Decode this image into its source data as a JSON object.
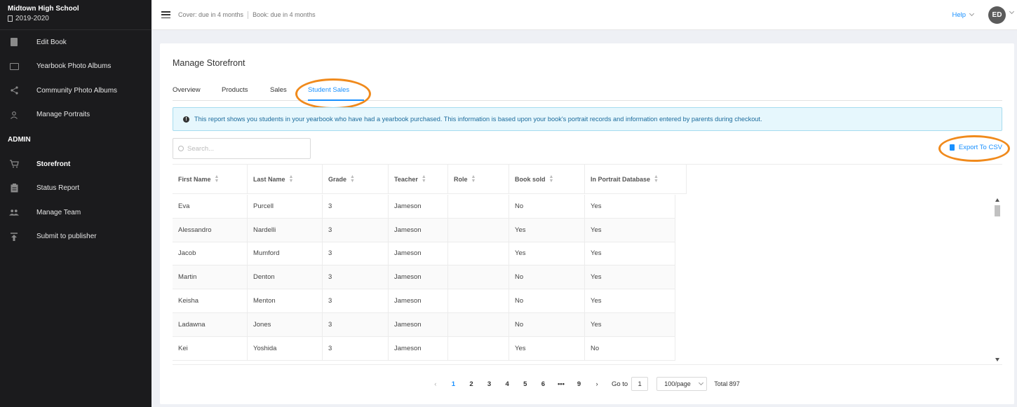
{
  "school": {
    "name": "Midtown High School",
    "year": "2019-2020"
  },
  "sidebar": {
    "items": [
      {
        "label": "Edit Book",
        "icon": "book-icon"
      },
      {
        "label": "Yearbook Photo Albums",
        "icon": "photo-album-icon"
      },
      {
        "label": "Community Photo Albums",
        "icon": "share-icon"
      },
      {
        "label": "Manage Portraits",
        "icon": "person-icon"
      }
    ],
    "admin_heading": "ADMIN",
    "admin_items": [
      {
        "label": "Storefront",
        "icon": "cart-icon",
        "active": true
      },
      {
        "label": "Status Report",
        "icon": "clipboard-icon"
      },
      {
        "label": "Manage Team",
        "icon": "team-icon"
      },
      {
        "label": "Submit to publisher",
        "icon": "upload-icon"
      }
    ]
  },
  "topbar": {
    "cover_due": "Cover: due in 4 months",
    "book_due": "Book: due in 4 months",
    "help": "Help",
    "avatar_initials": "ED"
  },
  "page": {
    "title": "Manage Storefront",
    "tabs": [
      "Overview",
      "Products",
      "Sales",
      "Student Sales"
    ],
    "active_tab": "Student Sales",
    "info": "This report shows you students in your yearbook who have had a yearbook purchased. This information is based upon your book's portrait records and information entered by parents during checkout.",
    "search_placeholder": "Search...",
    "export_label": "Export To CSV"
  },
  "table": {
    "columns": [
      "First Name",
      "Last Name",
      "Grade",
      "Teacher",
      "Role",
      "Book sold",
      "In Portrait Database"
    ],
    "rows": [
      [
        "Eva",
        "Purcell",
        "3",
        "Jameson",
        "",
        "No",
        "Yes"
      ],
      [
        "Alessandro",
        "Nardelli",
        "3",
        "Jameson",
        "",
        "Yes",
        "Yes"
      ],
      [
        "Jacob",
        "Mumford",
        "3",
        "Jameson",
        "",
        "Yes",
        "Yes"
      ],
      [
        "Martin",
        "Denton",
        "3",
        "Jameson",
        "",
        "No",
        "Yes"
      ],
      [
        "Keisha",
        "Menton",
        "3",
        "Jameson",
        "",
        "No",
        "Yes"
      ],
      [
        "Ladawna",
        "Jones",
        "3",
        "Jameson",
        "",
        "No",
        "Yes"
      ],
      [
        "Kei",
        "Yoshida",
        "3",
        "Jameson",
        "",
        "Yes",
        "No"
      ]
    ]
  },
  "pagination": {
    "pages": [
      "1",
      "2",
      "3",
      "4",
      "5",
      "6",
      "•••",
      "9"
    ],
    "current": "1",
    "goto_label": "Go to",
    "goto_value": "1",
    "page_size": "100/page",
    "total": "Total 897"
  },
  "colors": {
    "accent": "#1890ff",
    "highlight_ring": "#f08a1c",
    "sidebar_bg": "#1b1b1d"
  }
}
